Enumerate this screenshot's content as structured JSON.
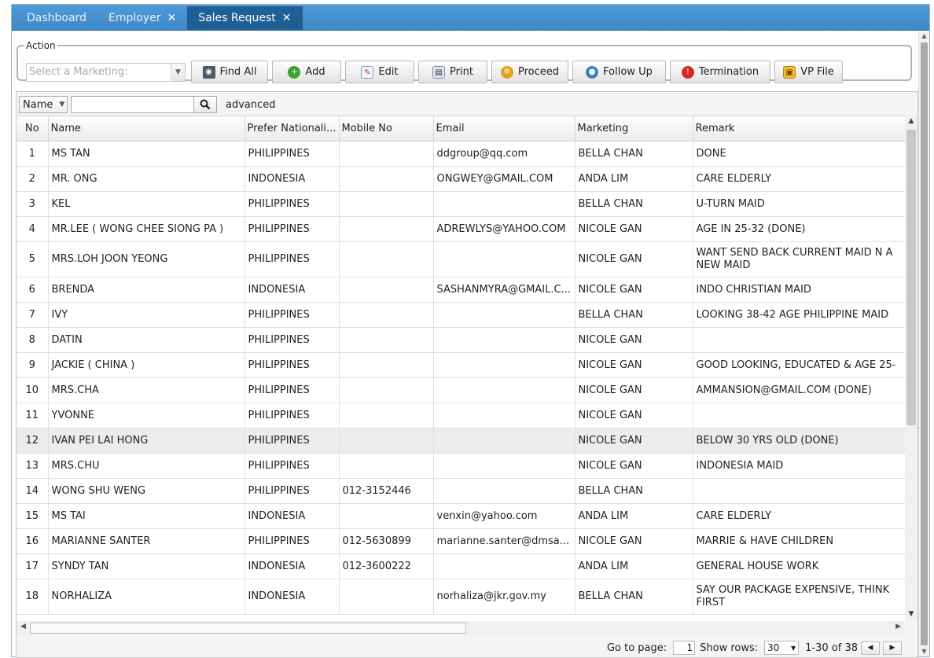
{
  "tabs": [
    {
      "label": "Dashboard",
      "closable": false,
      "active": false
    },
    {
      "label": "Employer",
      "closable": true,
      "active": false
    },
    {
      "label": "Sales Request",
      "closable": true,
      "active": true
    }
  ],
  "action": {
    "legend": "Action",
    "marketing_placeholder": "Select a Marketing:",
    "buttons": {
      "find_all": "Find All",
      "add": "Add",
      "edit": "Edit",
      "print": "Print",
      "proceed": "Proceed",
      "follow_up": "Follow Up",
      "termination": "Termination",
      "vp_file": "VP File"
    }
  },
  "search": {
    "field": "Name",
    "value": "",
    "advanced": "advanced"
  },
  "grid": {
    "columns": [
      "No",
      "Name",
      "Prefer Nationali...",
      "Mobile No",
      "Email",
      "Marketing",
      "Remark"
    ],
    "rows": [
      [
        "1",
        "MS TAN",
        "PHILIPPINES",
        "",
        "ddgroup@qq.com",
        "BELLA CHAN",
        "DONE"
      ],
      [
        "2",
        "MR. ONG",
        "INDONESIA",
        "",
        "ONGWEY@GMAIL.COM",
        "ANDA LIM",
        "CARE ELDERLY"
      ],
      [
        "3",
        "KEL",
        "PHILIPPINES",
        "",
        "",
        "BELLA CHAN",
        "U-TURN MAID"
      ],
      [
        "4",
        "MR.LEE ( WONG CHEE SIONG PA )",
        "PHILIPPINES",
        "",
        "ADREWLYS@YAHOO.COM",
        "NICOLE GAN",
        "AGE IN 25-32 (DONE)"
      ],
      [
        "5",
        "MRS.LOH JOON YEONG",
        "PHILIPPINES",
        "",
        "",
        "NICOLE GAN",
        "WANT SEND BACK CURRENT MAID N A NEW MAID"
      ],
      [
        "6",
        "BRENDA",
        "INDONESIA",
        "",
        "SASHANMYRA@GMAIL.C...",
        "NICOLE GAN",
        "INDO CHRISTIAN MAID"
      ],
      [
        "7",
        "IVY",
        "PHILIPPINES",
        "",
        "",
        "BELLA CHAN",
        "LOOKING 38-42 AGE PHILIPPINE MAID"
      ],
      [
        "8",
        "DATIN",
        "PHILIPPINES",
        "",
        "",
        "NICOLE GAN",
        ""
      ],
      [
        "9",
        "JACKIE ( CHINA )",
        "PHILIPPINES",
        "",
        "",
        "NICOLE GAN",
        "GOOD LOOKING, EDUCATED & AGE 25-"
      ],
      [
        "10",
        "MRS.CHA",
        "PHILIPPINES",
        "",
        "",
        "NICOLE GAN",
        "AMMANSION@GMAIL.COM (DONE)"
      ],
      [
        "11",
        "YVONNE",
        "PHILIPPINES",
        "",
        "",
        "NICOLE GAN",
        ""
      ],
      [
        "12",
        "IVAN PEI LAI HONG",
        "PHILIPPINES",
        "",
        "",
        "NICOLE GAN",
        "BELOW 30 YRS OLD (DONE)"
      ],
      [
        "13",
        "MRS.CHU",
        "PHILIPPINES",
        "",
        "",
        "NICOLE GAN",
        "INDONESIA MAID"
      ],
      [
        "14",
        "WONG SHU WENG",
        "PHILIPPINES",
        "012-3152446",
        "",
        "BELLA CHAN",
        ""
      ],
      [
        "15",
        "MS TAI",
        "INDONESIA",
        "",
        "venxin@yahoo.com",
        "ANDA LIM",
        "CARE ELDERLY"
      ],
      [
        "16",
        "MARIANNE SANTER",
        "PHILIPPINES",
        "012-5630899",
        "marianne.santer@dmsa...",
        "NICOLE GAN",
        "MARRIE & HAVE CHILDREN"
      ],
      [
        "17",
        "SYNDY TAN",
        "INDONESIA",
        "012-3600222",
        "",
        "ANDA LIM",
        "GENERAL HOUSE WORK"
      ],
      [
        "18",
        "NORHALIZA",
        "INDONESIA",
        "",
        "norhaliza@jkr.gov.my",
        "BELLA CHAN",
        "SAY OUR PACKAGE EXPENSIVE, THINK FIRST"
      ]
    ],
    "tall_rows": [
      5,
      18
    ],
    "selected_row": 12
  },
  "pager": {
    "go_to_label": "Go to page:",
    "page": "1",
    "show_rows_label": "Show rows:",
    "rows": "30",
    "range": "1-30 of 38"
  },
  "colors": {
    "tabbar": "#3d88c7",
    "active_tab": "#1f5f96"
  }
}
